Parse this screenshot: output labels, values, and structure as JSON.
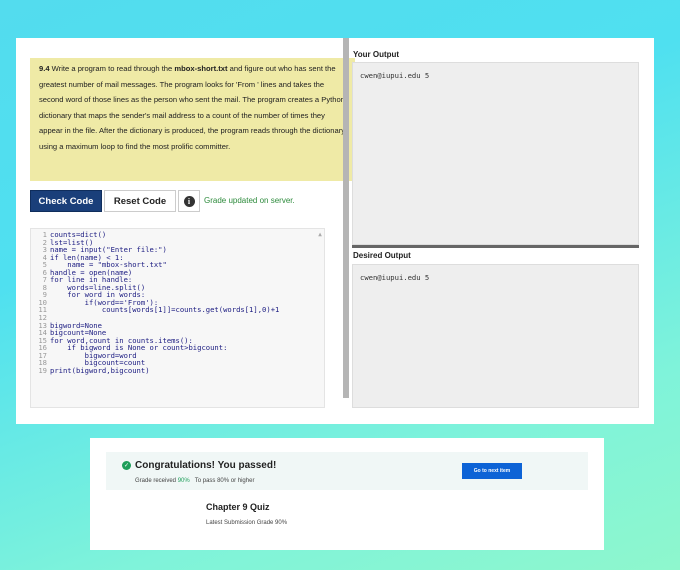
{
  "problem": {
    "number": "9.4",
    "intro": " Write a program to read through the ",
    "filename": "mbox-short.txt",
    "rest": " and figure out who has sent the greatest number of mail messages. The program looks for 'From ' lines and takes the second word of those lines as the person who sent the mail. The program creates a Python dictionary that maps the sender's mail address to a count of the number of times they appear in the file. After the dictionary is produced, the program reads through the dictionary using a maximum loop to find the most prolific committer."
  },
  "toolbar": {
    "check_label": "Check Code",
    "reset_label": "Reset Code",
    "info_icon": "info-icon",
    "status": "Grade updated on server."
  },
  "code_lines": [
    {
      "n": "1",
      "t": "counts=dict()"
    },
    {
      "n": "2",
      "t": "lst=list()"
    },
    {
      "n": "3",
      "t": "name = input(\"Enter file:\")"
    },
    {
      "n": "4",
      "t": "if len(name) < 1:"
    },
    {
      "n": "5",
      "t": "    name = \"mbox-short.txt\""
    },
    {
      "n": "6",
      "t": "handle = open(name)"
    },
    {
      "n": "7",
      "t": "for line in handle:"
    },
    {
      "n": "8",
      "t": "    words=line.split()"
    },
    {
      "n": "9",
      "t": "    for word in words:"
    },
    {
      "n": "10",
      "t": "        if(word=='From'):"
    },
    {
      "n": "11",
      "t": "            counts[words[1]]=counts.get(words[1],0)+1"
    },
    {
      "n": "12",
      "t": ""
    },
    {
      "n": "13",
      "t": "bigword=None"
    },
    {
      "n": "14",
      "t": "bigcount=None"
    },
    {
      "n": "15",
      "t": "for word,count in counts.items():"
    },
    {
      "n": "16",
      "t": "    if bigword is None or count>bigcount:"
    },
    {
      "n": "17",
      "t": "        bigword=word"
    },
    {
      "n": "18",
      "t": "        bigcount=count"
    },
    {
      "n": "19",
      "t": "print(bigword,bigcount)"
    }
  ],
  "your_output": {
    "label": "Your Output",
    "text": "cwen@iupui.edu 5"
  },
  "desired_output": {
    "label": "Desired Output",
    "text": "cwen@iupui.edu 5"
  },
  "result": {
    "check_icon": "check-circle-icon",
    "congrats": "Congratulations! You passed!",
    "grade_prefix": "Grade received ",
    "grade_value": "90%",
    "pass_text": "To pass 80% or higher",
    "next_button": "Go to next item",
    "quiz_title": "Chapter 9 Quiz",
    "latest": "Latest Submission Grade 90%"
  }
}
